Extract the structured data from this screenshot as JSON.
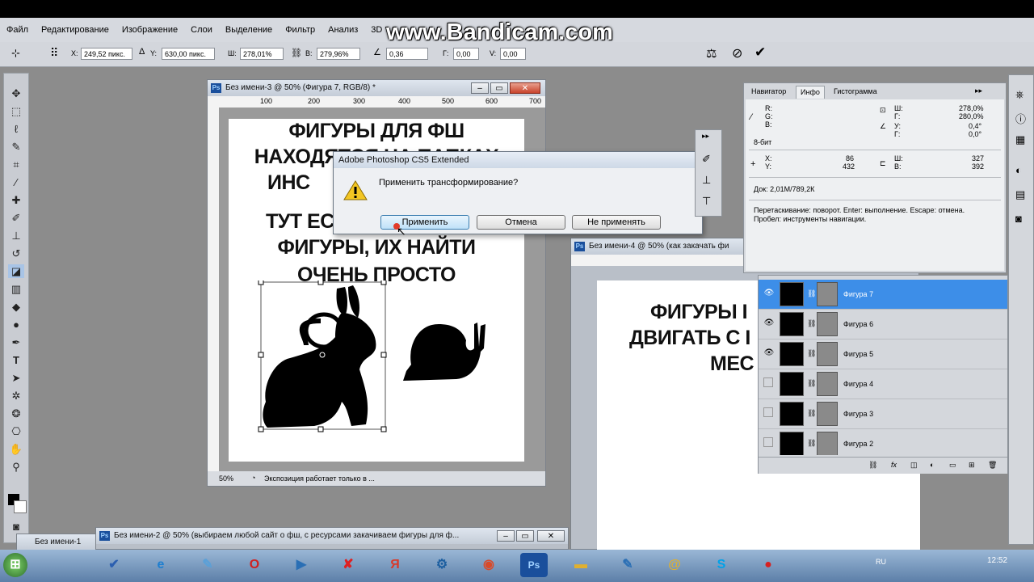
{
  "watermark": "www.Bandicam.com",
  "menu": [
    "Файл",
    "Редактирование",
    "Изображение",
    "Слои",
    "Выделение",
    "Фильтр",
    "Анализ",
    "3D"
  ],
  "options_bar": {
    "x_label": "X:",
    "x_value": "249,52 пикс.",
    "y_label": "Y:",
    "y_value": "630,00 пикс.",
    "w_label": "Ш:",
    "w_value": "278,01%",
    "h_label": "В:",
    "h_value": "279,96%",
    "angle_value": "0,36",
    "hskew_label": "Г:",
    "hskew_value": "0,00",
    "vskew_label": "V:",
    "vskew_value": "0,00"
  },
  "doc3": {
    "title": "Без имени-3 @ 50% (Фигура 7, RGB/8) *",
    "ruler_marks": [
      "100",
      "200",
      "300",
      "400",
      "500",
      "600",
      "700"
    ],
    "canvas_lines": [
      "ФИГУРЫ ДЛЯ ФШ",
      "НАХОДЯТСЯ НА ПАПКАХ",
      "ИНС",
      "ТУТ ЕС",
      "ФИГУРЫ, ИХ НАЙТИ",
      "ОЧЕНЬ ПРОСТО"
    ],
    "zoom": "50%",
    "status": "Экспозиция работает только в ..."
  },
  "doc4": {
    "title": "Без имени-4 @ 50% (как закачать фи",
    "canvas_lines": [
      "ФИГУРЫ I",
      "ДВИГАТЬ С I",
      "МЕС"
    ]
  },
  "doc2": {
    "title": "Без имени-2 @ 50% (выбираем любой сайт о фш, с ресурсами закачиваем фигуры для ф..."
  },
  "doc1": {
    "title": "Без имени-1"
  },
  "dialog": {
    "title": "Adobe Photoshop CS5 Extended",
    "message": "Применить трансформирование?",
    "apply": "Применить",
    "cancel": "Отмена",
    "dont_apply": "Не применять"
  },
  "info_panel": {
    "tabs": [
      "Навигатор",
      "Инфо",
      "Гистограмма"
    ],
    "r_label": "R:",
    "g_label": "G:",
    "b_label": "B:",
    "w_label": "Ш:",
    "w_value": "278,0%",
    "h_label": "Г:",
    "h_value": "280,0%",
    "angle_label": "У:",
    "angle_value": "0,4°",
    "skew_label": "Г:",
    "skew_value": "0,0°",
    "bits": "8-бит",
    "x_label": "X:",
    "x_value": "86",
    "y_label": "Y:",
    "y_value": "432",
    "w2_label": "Ш:",
    "w2_value": "327",
    "h2_label": "В:",
    "h2_value": "392",
    "doc_size": "Док: 2,01М/789,2К",
    "hint_line1": "Перетаскивание: поворот. Enter: выполнение. Escape: отмена.",
    "hint_line2": "Пробел: инструменты навигации."
  },
  "layers": [
    {
      "name": "Фигура 7",
      "visible": true,
      "selected": true
    },
    {
      "name": "Фигура 6",
      "visible": true,
      "selected": false
    },
    {
      "name": "Фигура 5",
      "visible": true,
      "selected": false
    },
    {
      "name": "Фигура 4",
      "visible": false,
      "selected": false
    },
    {
      "name": "Фигура 3",
      "visible": false,
      "selected": false
    },
    {
      "name": "Фигура 2",
      "visible": false,
      "selected": false
    }
  ],
  "taskbar": {
    "lang": "RU",
    "time": "12:52"
  }
}
